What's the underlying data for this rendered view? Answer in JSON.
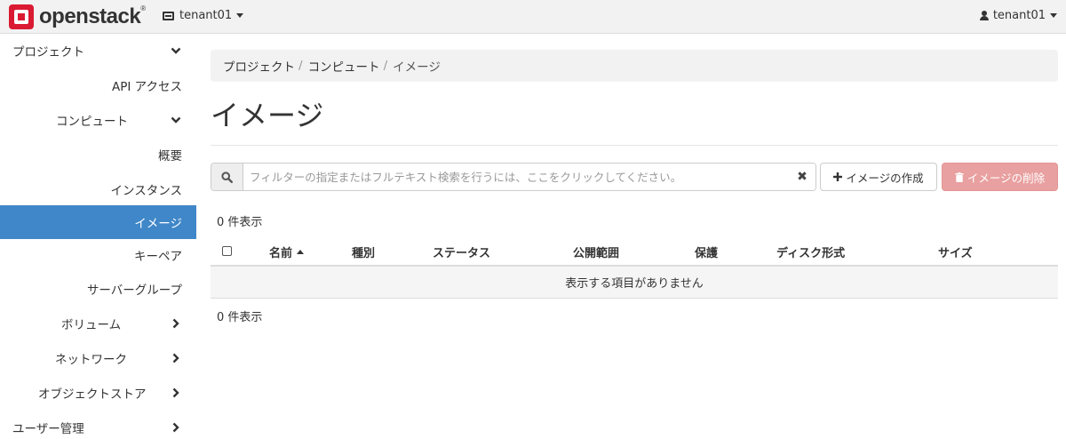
{
  "header": {
    "logo_text": "openstack",
    "logo_mark": "®",
    "tenant_label": "tenant01",
    "user_label": "tenant01",
    "icons": {
      "tenant": "server-icon",
      "user": "user-icon"
    }
  },
  "sidebar": {
    "items": [
      {
        "label": "プロジェクト",
        "chevron": "down"
      },
      {
        "label": "API アクセス"
      },
      {
        "label": "コンピュート",
        "chevron": "down"
      },
      {
        "label": "概要"
      },
      {
        "label": "インスタンス"
      },
      {
        "label": "イメージ",
        "active": true
      },
      {
        "label": "キーペア"
      },
      {
        "label": "サーバーグループ"
      },
      {
        "label": "ボリューム",
        "chevron": "right"
      },
      {
        "label": "ネットワーク",
        "chevron": "right"
      },
      {
        "label": "オブジェクトストア",
        "chevron": "right"
      },
      {
        "label": "ユーザー管理",
        "chevron": "right"
      }
    ]
  },
  "breadcrumb": [
    "プロジェクト",
    "コンピュート",
    "イメージ"
  ],
  "page_title": "イメージ",
  "filter": {
    "placeholder": "フィルターの指定またはフルテキスト検索を行うには、ここをクリックしてください。",
    "value": "",
    "clear_glyph": "✖"
  },
  "actions": {
    "create_label": "イメージの作成",
    "delete_label": "イメージの削除"
  },
  "table": {
    "count_top": "0 件表示",
    "count_bottom": "0 件表示",
    "columns": [
      "名前",
      "種別",
      "ステータス",
      "公開範囲",
      "保護",
      "ディスク形式",
      "サイズ"
    ],
    "sorted_column": "名前",
    "rows": [],
    "empty_message": "表示する項目がありません"
  },
  "colors": {
    "active_nav": "#3f87c8",
    "delete_button": "#e9a0a0",
    "brand": "#da1a32"
  }
}
